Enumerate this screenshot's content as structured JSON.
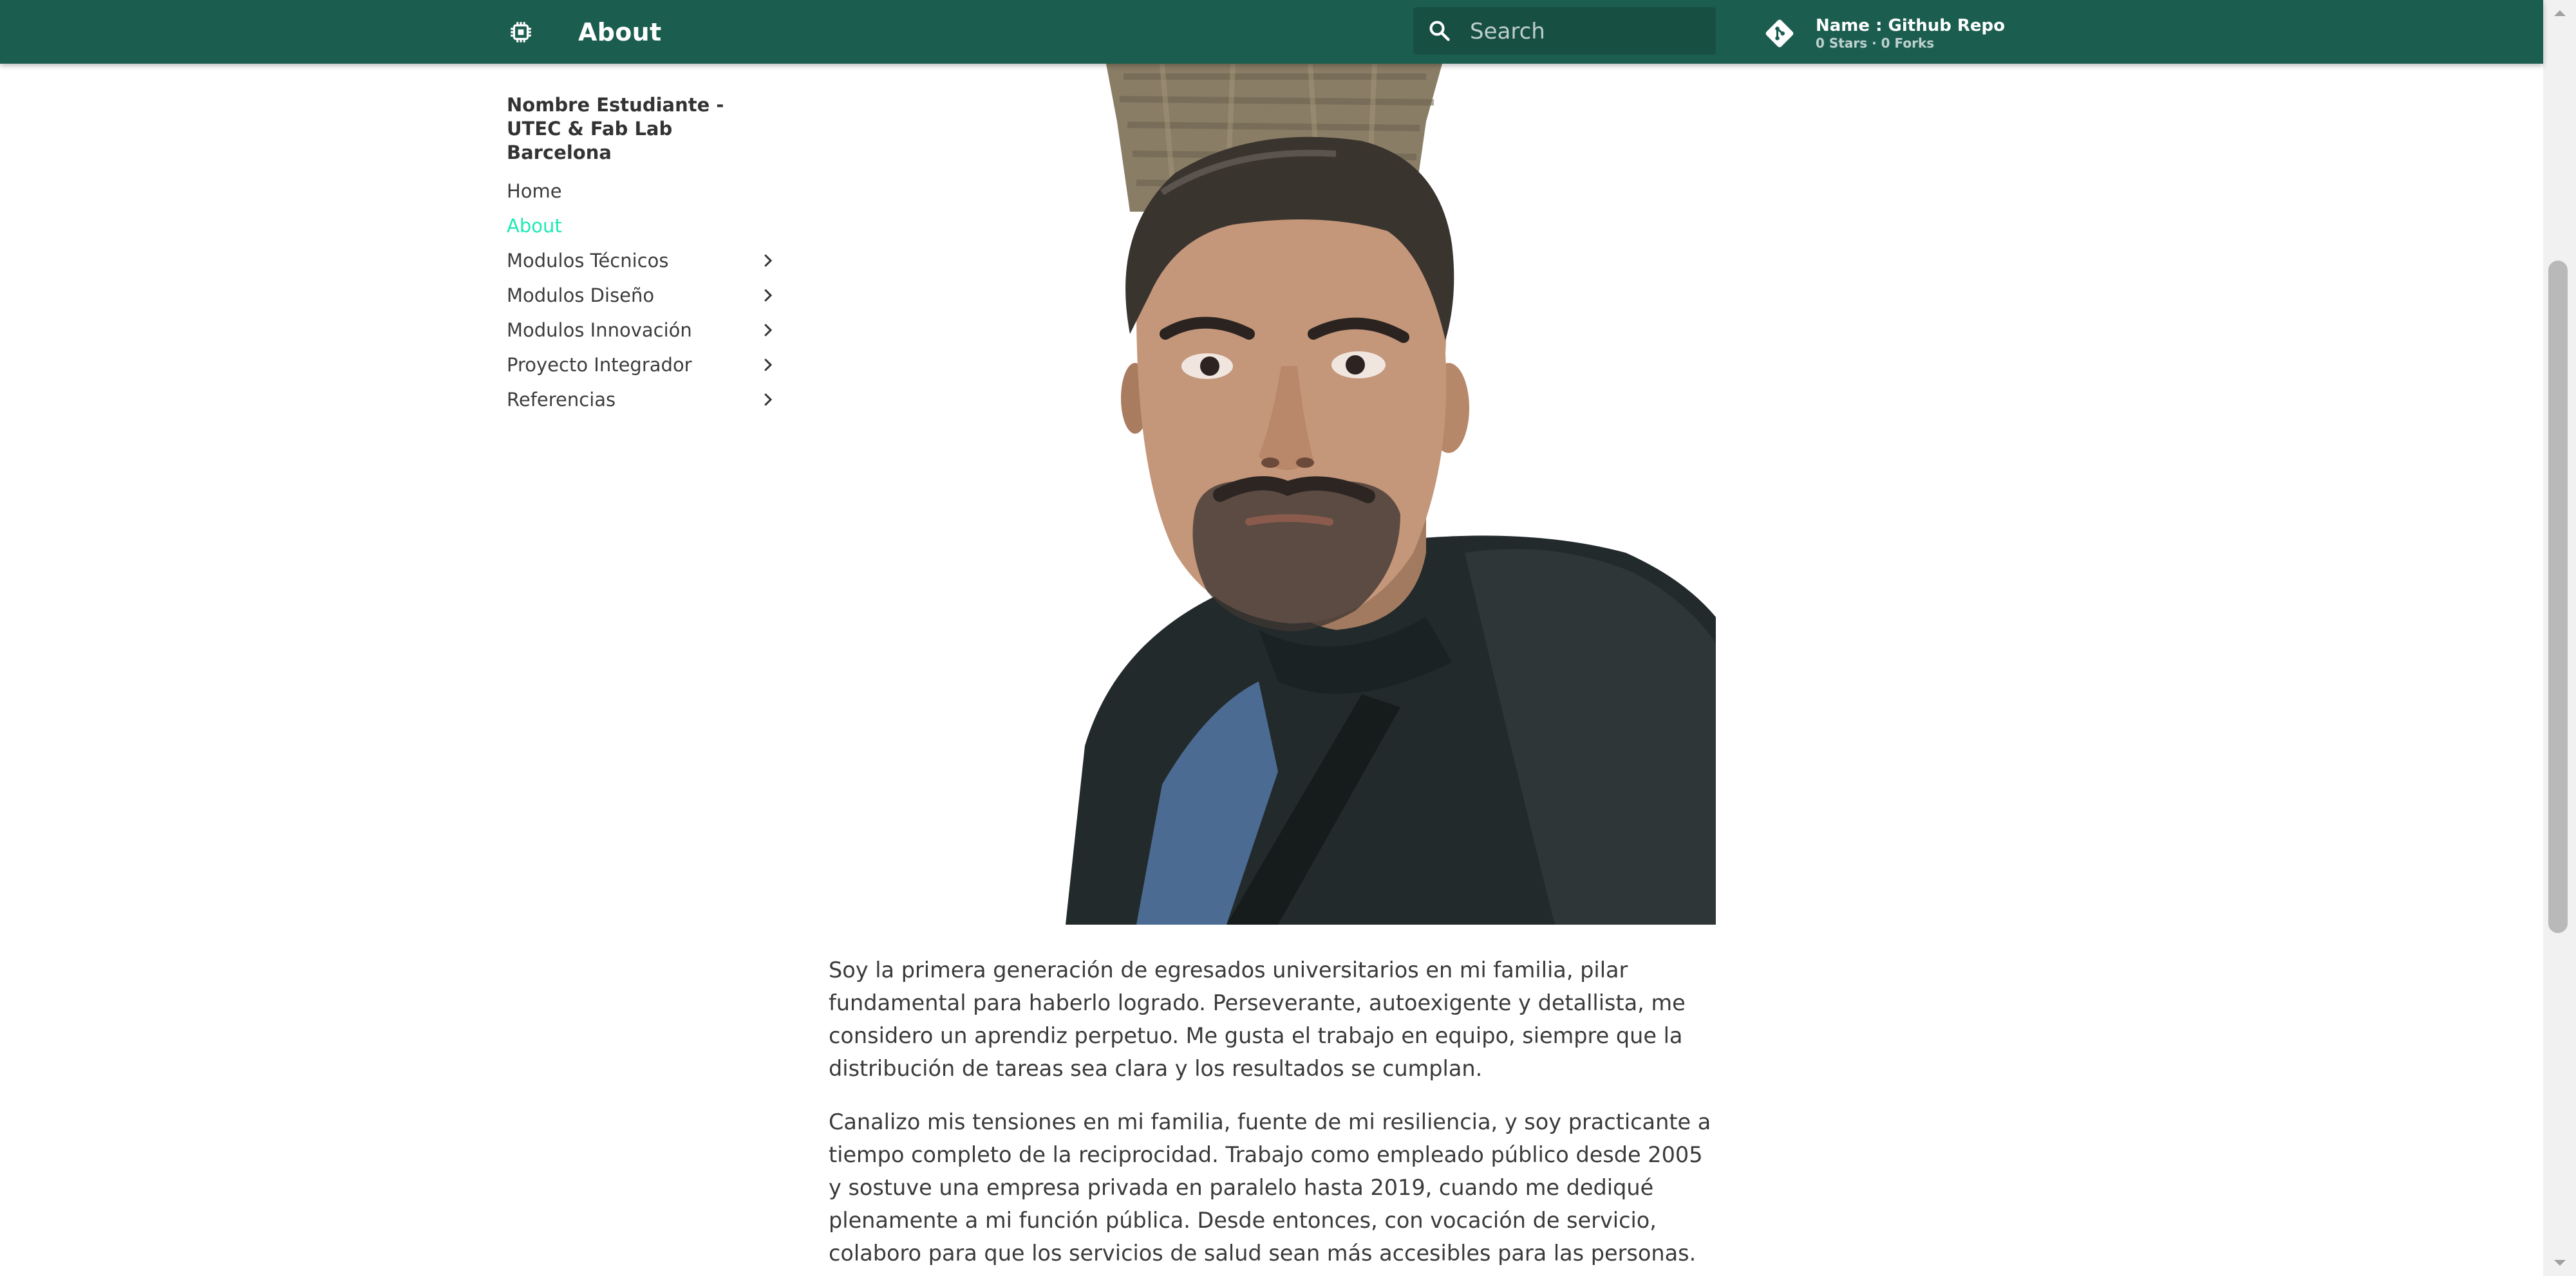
{
  "header": {
    "title": "About",
    "logo_icon": "chip-icon",
    "search": {
      "placeholder": "Search",
      "icon": "search-icon"
    },
    "repo": {
      "icon": "git-icon",
      "name": "Name : Github Repo",
      "facts": "0 Stars · 0 Forks"
    }
  },
  "nav": {
    "site_title": "Nombre Estudiante - UTEC & Fab Lab Barcelona",
    "items": [
      {
        "label": "Home",
        "expandable": false,
        "active": false
      },
      {
        "label": "About",
        "expandable": false,
        "active": true
      },
      {
        "label": "Modulos Técnicos",
        "expandable": true,
        "active": false
      },
      {
        "label": "Modulos Diseño",
        "expandable": true,
        "active": false
      },
      {
        "label": "Modulos Innovación",
        "expandable": true,
        "active": false
      },
      {
        "label": "Proyecto Integrador",
        "expandable": true,
        "active": false
      },
      {
        "label": "Referencias",
        "expandable": true,
        "active": false
      }
    ]
  },
  "content": {
    "paragraphs": [
      "Soy la primera generación de egresados universitarios en mi familia, pilar fundamental para haberlo logrado. Perseverante, autoexigente y detallista, me considero un aprendiz perpetuo. Me gusta el trabajo en equipo, siempre que la distribución de tareas sea clara y los resultados se cumplan.",
      "Canalizo mis tensiones en mi familia, fuente de mi resiliencia, y soy practicante a tiempo completo de la reciprocidad. Trabajo como empleado público desde 2005 y sostuve una empresa privada en paralelo hasta 2019, cuando me dediqué plenamente a mi función pública. Desde entonces, con vocación de servicio, colaboro para que los servicios de salud sean más accesibles para las personas."
    ]
  },
  "colors": {
    "header_bg": "#1b5e4f",
    "search_bg": "#174f43",
    "active_link": "#1de9b6",
    "text": "#3a3a3a"
  }
}
